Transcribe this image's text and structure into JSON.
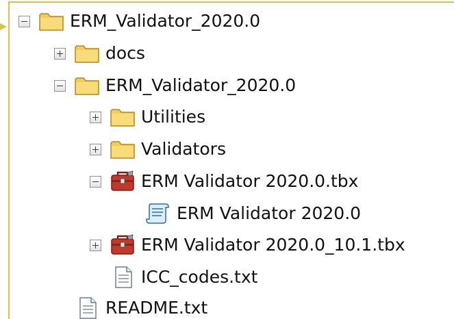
{
  "tree": {
    "root": {
      "label": "ERM_Validator_2020.0",
      "icon": "folder-icon",
      "expanded": true
    },
    "docs": {
      "label": "docs",
      "icon": "folder-icon",
      "expanded": false
    },
    "erm_folder": {
      "label": "ERM_Validator_2020.0",
      "icon": "folder-icon",
      "expanded": true
    },
    "utilities": {
      "label": "Utilities",
      "icon": "folder-icon",
      "expanded": false
    },
    "validators": {
      "label": "Validators",
      "icon": "folder-icon",
      "expanded": false
    },
    "tbx_2020": {
      "label": "ERM Validator 2020.0.tbx",
      "icon": "toolbox-icon",
      "expanded": true
    },
    "script_tool": {
      "label": "ERM Validator 2020.0",
      "icon": "script-icon"
    },
    "tbx_10_1": {
      "label": "ERM Validator 2020.0_10.1.tbx",
      "icon": "toolbox-icon",
      "expanded": false
    },
    "icc_codes": {
      "label": "ICC_codes.txt",
      "icon": "text-file-icon"
    },
    "readme": {
      "label": "README.txt",
      "icon": "text-file-icon"
    }
  },
  "colors": {
    "frame_accent": "#d8c24a",
    "folder": "#f2cd55",
    "toolbox": "#c0392b"
  }
}
